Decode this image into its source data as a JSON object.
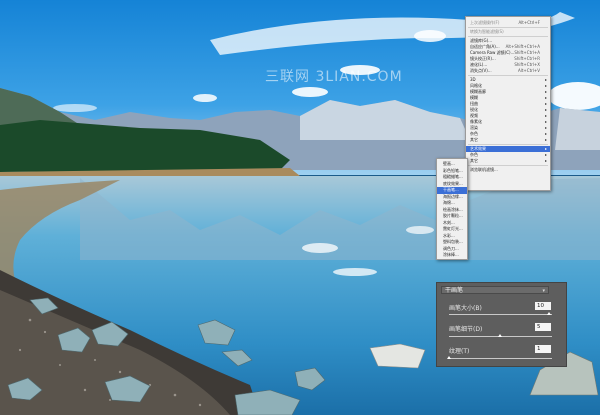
{
  "watermark": "三联网 3LIAN.COM",
  "main_menu": {
    "items": [
      {
        "label": "上次滤镜操作(F)",
        "shortcut": "Alt+Ctrl+F",
        "dim": true
      },
      {
        "sep": true
      },
      {
        "label": "转换为智能滤镜(S)",
        "shortcut": "",
        "dim": true
      },
      {
        "sep": true
      },
      {
        "label": "滤镜库(G)...",
        "shortcut": ""
      },
      {
        "label": "自适应广角(A)...",
        "shortcut": "Alt+Shift+Ctrl+A"
      },
      {
        "label": "Camera Raw 滤镜(C)...",
        "shortcut": "Shift+Ctrl+A"
      },
      {
        "label": "镜头校正(R)...",
        "shortcut": "Shift+Ctrl+R"
      },
      {
        "label": "液化(L)...",
        "shortcut": "Shift+Ctrl+X"
      },
      {
        "label": "消失点(V)...",
        "shortcut": "Alt+Ctrl+V"
      },
      {
        "sep": true
      },
      {
        "label": "3D",
        "arrow": true
      },
      {
        "label": "风格化",
        "arrow": true
      },
      {
        "label": "模糊画廊",
        "arrow": true
      },
      {
        "label": "模糊",
        "arrow": true
      },
      {
        "label": "扭曲",
        "arrow": true
      },
      {
        "label": "锐化",
        "arrow": true
      },
      {
        "label": "视频",
        "arrow": true
      },
      {
        "label": "像素化",
        "arrow": true
      },
      {
        "label": "渲染",
        "arrow": true
      },
      {
        "label": "杂色",
        "arrow": true
      },
      {
        "label": "其它",
        "arrow": true
      },
      {
        "sep": true
      },
      {
        "label": "艺术效果",
        "arrow": true,
        "highlight": true
      },
      {
        "label": "杂色",
        "arrow": true
      },
      {
        "label": "其它",
        "arrow": true
      },
      {
        "sep": true
      },
      {
        "label": "浏览联机滤镜...",
        "shortcut": ""
      }
    ]
  },
  "sub_menu": {
    "items": [
      {
        "label": "壁画..."
      },
      {
        "label": "彩色铅笔..."
      },
      {
        "label": "粗糙蜡笔..."
      },
      {
        "label": "底纹效果..."
      },
      {
        "label": "干画笔...",
        "highlight": true
      },
      {
        "label": "海报边缘..."
      },
      {
        "label": "海绵..."
      },
      {
        "label": "绘画涂抹..."
      },
      {
        "label": "胶片颗粒..."
      },
      {
        "label": "木刻..."
      },
      {
        "label": "霓虹灯光..."
      },
      {
        "label": "水彩..."
      },
      {
        "label": "塑料包装..."
      },
      {
        "label": "调色刀..."
      },
      {
        "label": "涂抹棒..."
      }
    ]
  },
  "panel": {
    "dropdown_value": "干画笔",
    "rows": [
      {
        "label": "画笔大小(B)",
        "value": "10",
        "fraction": 0.99
      },
      {
        "label": "画笔细节(D)",
        "value": "5",
        "fraction": 0.5
      },
      {
        "label": "纹理(T)",
        "value": "1",
        "fraction": 0.0
      }
    ]
  },
  "colors": {
    "menu_bg": "#f0f0f0",
    "highlight": "#3b6fd6",
    "panel_bg": "#5e5e5e"
  }
}
